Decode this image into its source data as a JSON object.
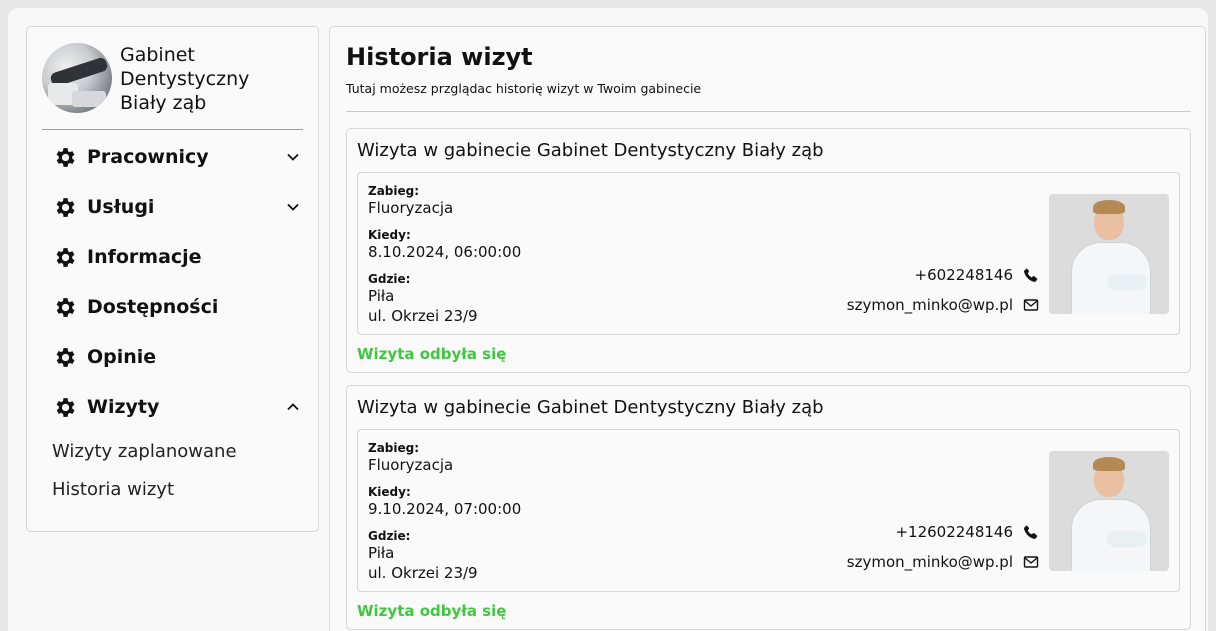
{
  "sidebar": {
    "clinic_name": "Gabinet Dentystyczny Biały ząb",
    "nav": [
      {
        "label": "Pracownicy",
        "expandable": true,
        "expanded": false
      },
      {
        "label": "Usługi",
        "expandable": true,
        "expanded": false
      },
      {
        "label": "Informacje",
        "expandable": false
      },
      {
        "label": "Dostępności",
        "expandable": false
      },
      {
        "label": "Opinie",
        "expandable": false
      },
      {
        "label": "Wizyty",
        "expandable": true,
        "expanded": true
      }
    ],
    "sub_items": [
      "Wizyty zaplanowane",
      "Historia wizyt"
    ]
  },
  "main": {
    "title": "Historia wizyt",
    "subtitle": "Tutaj możesz przglądac historię wizyt w Twoim gabinecie",
    "labels": {
      "procedure": "Zabieg:",
      "when": "Kiedy:",
      "where": "Gdzie:"
    },
    "visits": [
      {
        "title": "Wizyta w gabinecie Gabinet Dentystyczny Biały ząb",
        "procedure": "Fluoryzacja",
        "when": "8.10.2024, 06:00:00",
        "city": "Piła",
        "address": "ul. Okrzei 23/9",
        "phone": "+602248146",
        "email": "szymon_minko@wp.pl",
        "status": "Wizyta odbyła się"
      },
      {
        "title": "Wizyta w gabinecie Gabinet Dentystyczny Biały ząb",
        "procedure": "Fluoryzacja",
        "when": "9.10.2024, 07:00:00",
        "city": "Piła",
        "address": "ul. Okrzei 23/9",
        "phone": "+12602248146",
        "email": "szymon_minko@wp.pl",
        "status": "Wizyta odbyła się"
      }
    ]
  },
  "colors": {
    "status_green": "#3fc83f"
  },
  "icons": [
    "gear-icon",
    "chevron-down-icon",
    "chevron-up-icon",
    "phone-icon",
    "mail-icon"
  ]
}
